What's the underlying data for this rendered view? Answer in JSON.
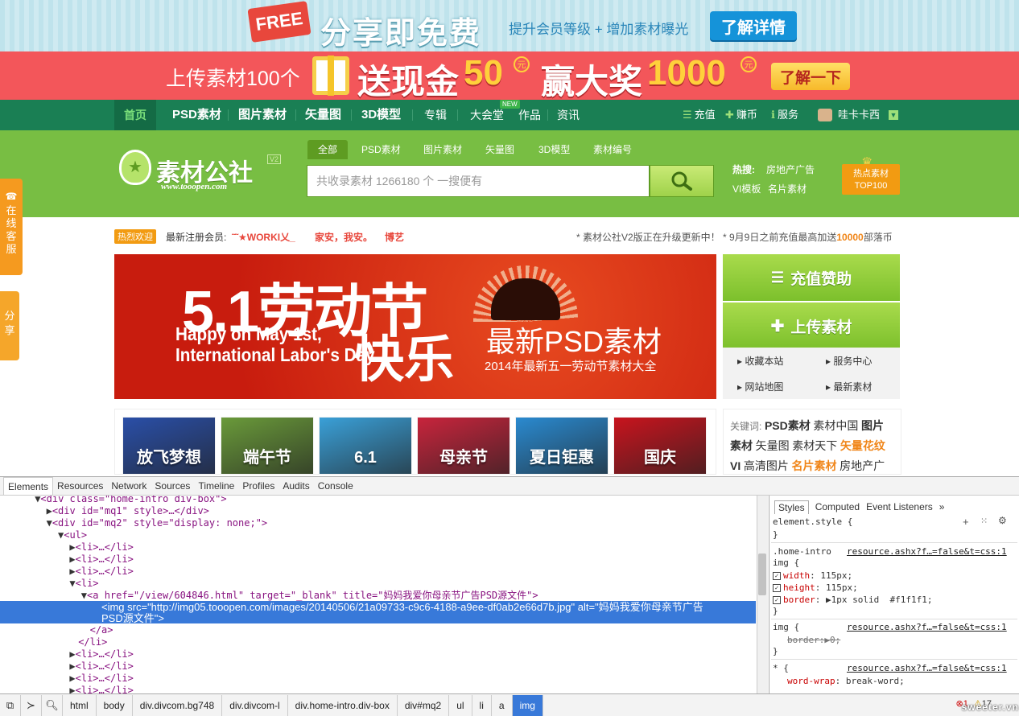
{
  "banner_top": {
    "badge": "FREE",
    "title": "分享即免费",
    "subtitle": "提升会员等级 + 增加素材曝光",
    "button": "了解详情"
  },
  "banner_promo": {
    "text1": "上传素材100个",
    "text2": "送现金",
    "amount1": "50",
    "yuan": "元",
    "text3": "赢大奖",
    "amount2": "1000",
    "button": "了解一下"
  },
  "nav": {
    "items": [
      "首页",
      "PSD素材",
      "图片素材",
      "矢量图",
      "3D模型",
      "专辑",
      "大会堂",
      "作品",
      "资讯"
    ],
    "new_badge": "NEW",
    "right": [
      "充值",
      "赚币",
      "服务",
      "哇卡卡西"
    ]
  },
  "header": {
    "logo_text": "素材公社",
    "logo_version": "V2",
    "logo_url": "www.tooopen.com",
    "search_tabs": [
      "全部",
      "PSD素材",
      "图片素材",
      "矢量图",
      "3D模型",
      "素材编号"
    ],
    "search_placeholder": "共收录素材 1266180 个 一搜便有",
    "hot_label": "热搜:",
    "hot_links": [
      "房地产广告",
      "VI模板",
      "名片素材"
    ],
    "top_badge_line1": "热点素材",
    "top_badge_line2": "TOP100"
  },
  "side_float": {
    "service": "在线客服",
    "share": "分享"
  },
  "infobar": {
    "welcome": "热烈欢迎",
    "members_label": "最新注册会员:",
    "members": [
      "˜˜★WORKI乂_",
      "家安，我安。",
      "博艺"
    ],
    "notice1": "* 素材公社V2版正在升级更新中！",
    "notice2_pre": "* 9月9日之前充值最高加送",
    "notice2_num": "10000",
    "notice2_post": "部落币"
  },
  "main_banner": {
    "title": "5.1劳动节",
    "english_line1": "Happy on May 1st,",
    "english_line2": "International Labor's Day",
    "kuaile": "快乐",
    "psd": "最新PSD素材",
    "sub": "2014年最新五一劳动节素材大全"
  },
  "right_panel": {
    "recharge": "充值赞助",
    "upload": "上传素材",
    "links": [
      "收藏本站",
      "服务中心",
      "网站地图",
      "最新素材"
    ]
  },
  "thumbs": [
    {
      "label": "放飞梦想",
      "color": "#2a4fa8"
    },
    {
      "label": "端午节",
      "color": "#6a9a3a"
    },
    {
      "label": "6.1",
      "color": "#3aa0d8"
    },
    {
      "label": "母亲节",
      "color": "#c8243c"
    },
    {
      "label": "夏日钜惠",
      "color": "#2a8ad0"
    },
    {
      "label": "国庆",
      "color": "#c8141e"
    }
  ],
  "keywords": {
    "label": "关键词:",
    "items": [
      {
        "text": "PSD素材",
        "style": "b"
      },
      {
        "text": "素材中国",
        "style": ""
      },
      {
        "text": "图片",
        "style": "b"
      },
      {
        "text": "素材",
        "style": "b"
      },
      {
        "text": "矢量图",
        "style": ""
      },
      {
        "text": "素材天下",
        "style": ""
      },
      {
        "text": "矢量花纹",
        "style": "o"
      },
      {
        "text": "VI",
        "style": "b"
      },
      {
        "text": "高清图片",
        "style": ""
      },
      {
        "text": "名片素材",
        "style": "o"
      },
      {
        "text": "房地产广",
        "style": ""
      }
    ]
  },
  "devtools": {
    "tabs": [
      "Elements",
      "Resources",
      "Network",
      "Sources",
      "Timeline",
      "Profiles",
      "Audits",
      "Console"
    ],
    "dom_lines": [
      {
        "indent": 6,
        "arrow": "▼",
        "text": "<div class=\"home-intro div-box\">"
      },
      {
        "indent": 8,
        "arrow": "▶",
        "text": "<div id=\"mq1\" style>…</div>"
      },
      {
        "indent": 8,
        "arrow": "▼",
        "text": "<div id=\"mq2\" style=\"display: none;\">"
      },
      {
        "indent": 10,
        "arrow": "▼",
        "text": "<ul>"
      },
      {
        "indent": 12,
        "arrow": "▶",
        "text": "<li>…</li>"
      },
      {
        "indent": 12,
        "arrow": "▶",
        "text": "<li>…</li>"
      },
      {
        "indent": 12,
        "arrow": "▶",
        "text": "<li>…</li>"
      },
      {
        "indent": 12,
        "arrow": "▼",
        "text": "<li>"
      },
      {
        "indent": 14,
        "arrow": "▼",
        "text": "<a href=\"/view/604846.html\" target=\"_blank\" title=\"妈妈我爱你母亲节广告PSD源文件\">"
      }
    ],
    "selected_line1": "<img src=\"http://img05.tooopen.com/images/20140506/21a09733-c9c6-4188-a9ee-df0ab2e66d7b.jpg\" alt=\"妈妈我爱你母亲节广告",
    "selected_line2": "PSD源文件\">",
    "dom_after": [
      {
        "indent": 14,
        "arrow": "",
        "text": "</a>"
      },
      {
        "indent": 12,
        "arrow": "",
        "text": "</li>"
      },
      {
        "indent": 12,
        "arrow": "▶",
        "text": "<li>…</li>"
      },
      {
        "indent": 12,
        "arrow": "▶",
        "text": "<li>…</li>"
      },
      {
        "indent": 12,
        "arrow": "▶",
        "text": "<li>…</li>"
      },
      {
        "indent": 12,
        "arrow": "▶",
        "text": "<li>…</li>"
      }
    ],
    "styles_tabs": [
      "Styles",
      "Computed",
      "Event Listeners",
      "»"
    ],
    "element_style": "element.style {",
    "rule1_selector1": ".home-intro",
    "rule1_selector2": "img {",
    "rule1_source": "resource.ashx?f…=false&t=css:1",
    "rule1_props": [
      {
        "name": "width",
        "value": "115px;"
      },
      {
        "name": "height",
        "value": "115px;"
      },
      {
        "name": "border",
        "value": "▶1px solid  #f1f1f1;"
      }
    ],
    "rule2_selector": "img {",
    "rule2_source": "resource.ashx?f…=false&t=css:1",
    "rule2_prop": "border:▶0;",
    "rule3_selector": "* {",
    "rule3_source": "resource.ashx?f…=false&t=css:1",
    "rule3_prop_name": "word-wrap",
    "rule3_prop_value": "break-word;",
    "close_brace": "}",
    "crumbs": [
      "html",
      "body",
      "div.divcom.bg748",
      "div.divcom-l",
      "div.home-intro.div-box",
      "div#mq2",
      "ul",
      "li",
      "a",
      "img"
    ],
    "error_count": "1",
    "warn_count": "17",
    "watermark": "sweeter.vn"
  }
}
